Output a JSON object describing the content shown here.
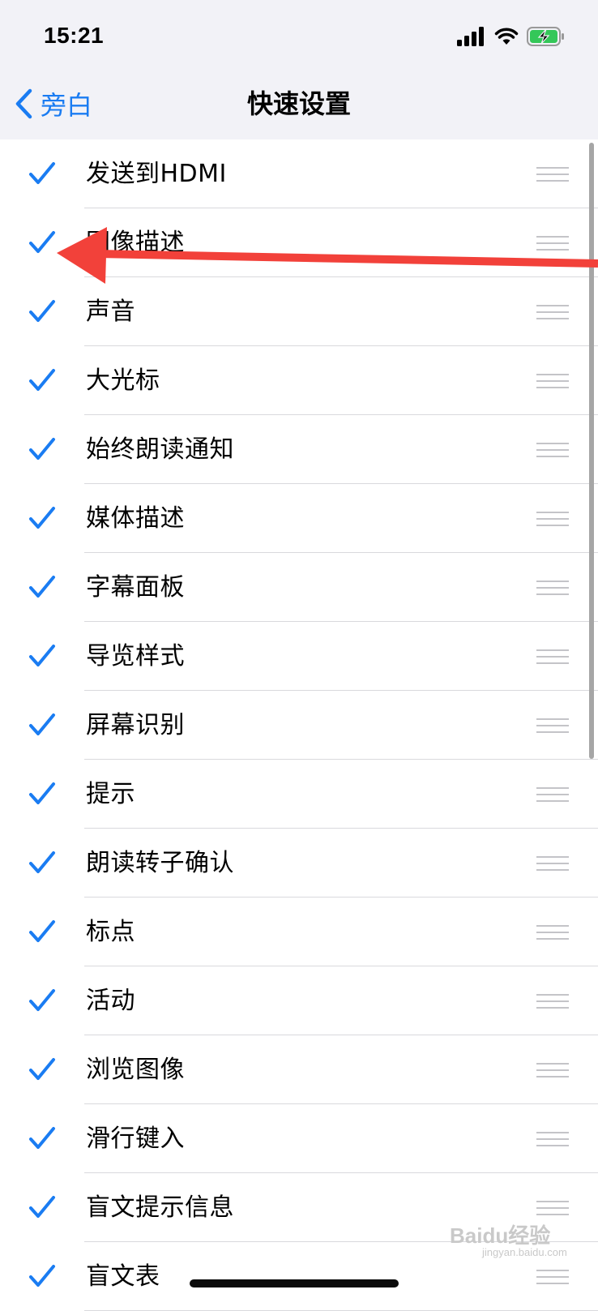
{
  "status_bar": {
    "time": "15:21"
  },
  "nav": {
    "back_label": "旁白",
    "title": "快速设置"
  },
  "items": [
    {
      "label": "发送到HDMI",
      "checked": true
    },
    {
      "label": "图像描述",
      "checked": true
    },
    {
      "label": "声音",
      "checked": true
    },
    {
      "label": "大光标",
      "checked": true
    },
    {
      "label": "始终朗读通知",
      "checked": true
    },
    {
      "label": "媒体描述",
      "checked": true
    },
    {
      "label": "字幕面板",
      "checked": true
    },
    {
      "label": "导览样式",
      "checked": true
    },
    {
      "label": "屏幕识别",
      "checked": true
    },
    {
      "label": "提示",
      "checked": true
    },
    {
      "label": "朗读转子确认",
      "checked": true
    },
    {
      "label": "标点",
      "checked": true
    },
    {
      "label": "活动",
      "checked": true
    },
    {
      "label": "浏览图像",
      "checked": true
    },
    {
      "label": "滑行键入",
      "checked": true
    },
    {
      "label": "盲文提示信息",
      "checked": true
    },
    {
      "label": "盲文表",
      "checked": true
    }
  ],
  "watermark": {
    "main": "Baidu经验",
    "sub": "jingyan.baidu.com"
  },
  "colors": {
    "accent": "#1a7cf2",
    "arrow": "#f2413a",
    "nav_bg": "#f2f2f7",
    "battery_fill": "#34c759"
  },
  "icons": [
    "chevron-left-icon",
    "checkmark-icon",
    "drag-handle-icon",
    "signal-icon",
    "wifi-icon",
    "battery-charging-icon"
  ]
}
